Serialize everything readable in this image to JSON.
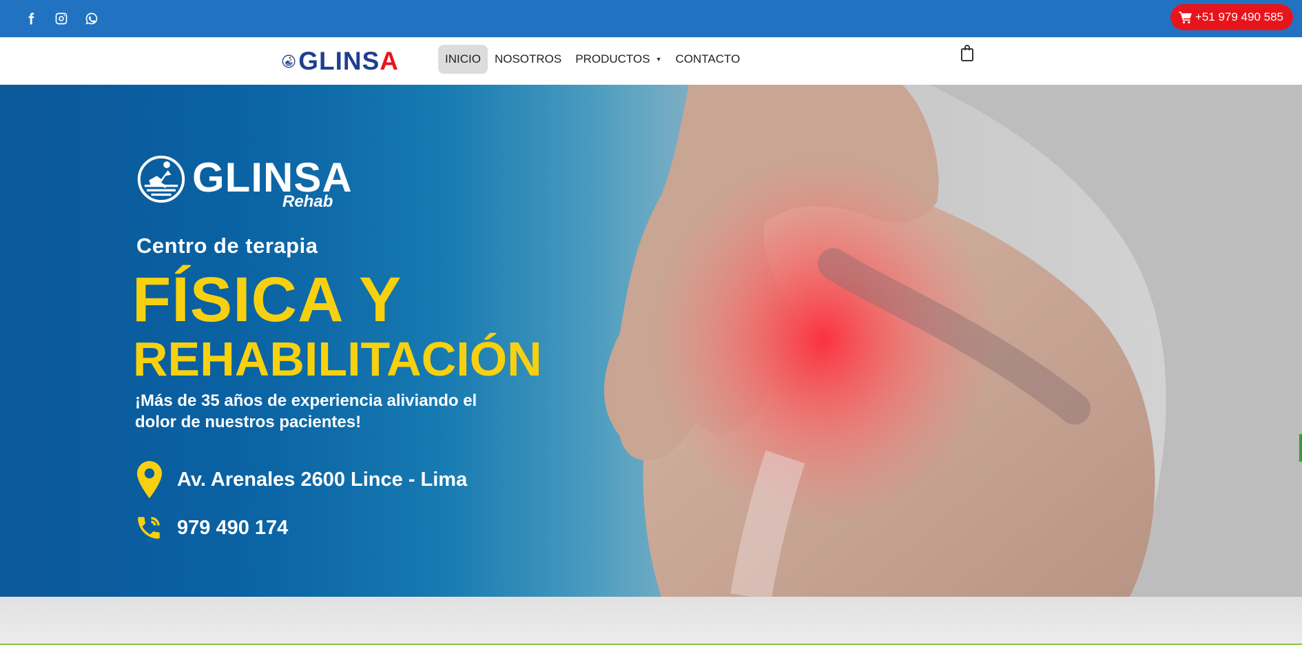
{
  "topbar": {
    "social": [
      {
        "name": "facebook-icon"
      },
      {
        "name": "instagram-icon"
      },
      {
        "name": "whatsapp-icon"
      }
    ],
    "phone_label": "+51 979 490 585",
    "bg_color": "#2173c2",
    "phone_color": "#e8141c"
  },
  "header": {
    "logo_text_main": "GLINS",
    "logo_text_accent": "A",
    "nav": [
      {
        "label": "INICIO",
        "active": true
      },
      {
        "label": "NOSOTROS"
      },
      {
        "label": "PRODUCTOS",
        "has_dropdown": true
      },
      {
        "label": "CONTACTO"
      }
    ]
  },
  "hero": {
    "logo_text": "GLINSA",
    "logo_sub": "Rehab",
    "subtitle": "Centro de terapia",
    "title_line1": "FÍSICA  Y",
    "title_line2": "REHABILITACIÓN",
    "body": "¡Más de 35 años de experiencia aliviando el dolor de nuestros pacientes!",
    "address": "Av. Arenales 2600 Lince - Lima",
    "phone": "979 490 174",
    "accent_color": "#f7d10f"
  }
}
